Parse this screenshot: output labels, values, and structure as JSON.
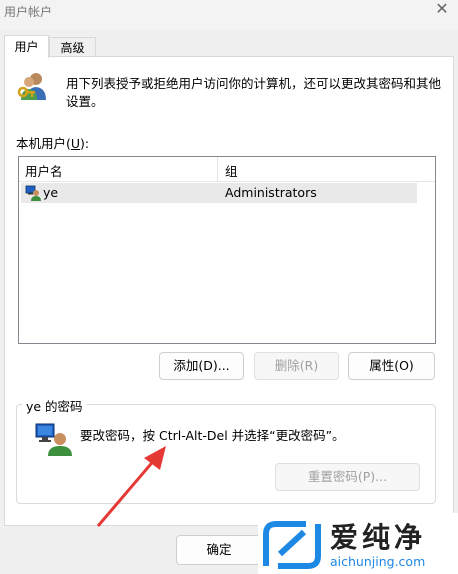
{
  "window": {
    "title": "用户帐户",
    "close_glyph": "✕"
  },
  "tabs": [
    {
      "label": "用户"
    },
    {
      "label": "高级"
    }
  ],
  "intro_text": "用下列表授予或拒绝用户访问你的计算机，还可以更改其密码和其他设置。",
  "users_label_prefix": "本机用户(",
  "users_label_key": "U",
  "users_label_suffix": "):",
  "list": {
    "columns": [
      "用户名",
      "组"
    ],
    "rows": [
      {
        "name": "ye",
        "group": "Administrators"
      }
    ]
  },
  "buttons": {
    "add": "添加(D)...",
    "remove": "删除(R)",
    "properties": "属性(O)",
    "reset_password": "重置密码(P)...",
    "ok": "确定"
  },
  "password_group": {
    "title": "ye 的密码",
    "message": "要改密码，按 Ctrl-Alt-Del 并选择“更改密码”。"
  },
  "watermark": {
    "title": "爱纯净",
    "url": "aichunjing.com"
  },
  "colors": {
    "accent_blue": "#1e88e5",
    "arrow_red": "#e53935"
  }
}
